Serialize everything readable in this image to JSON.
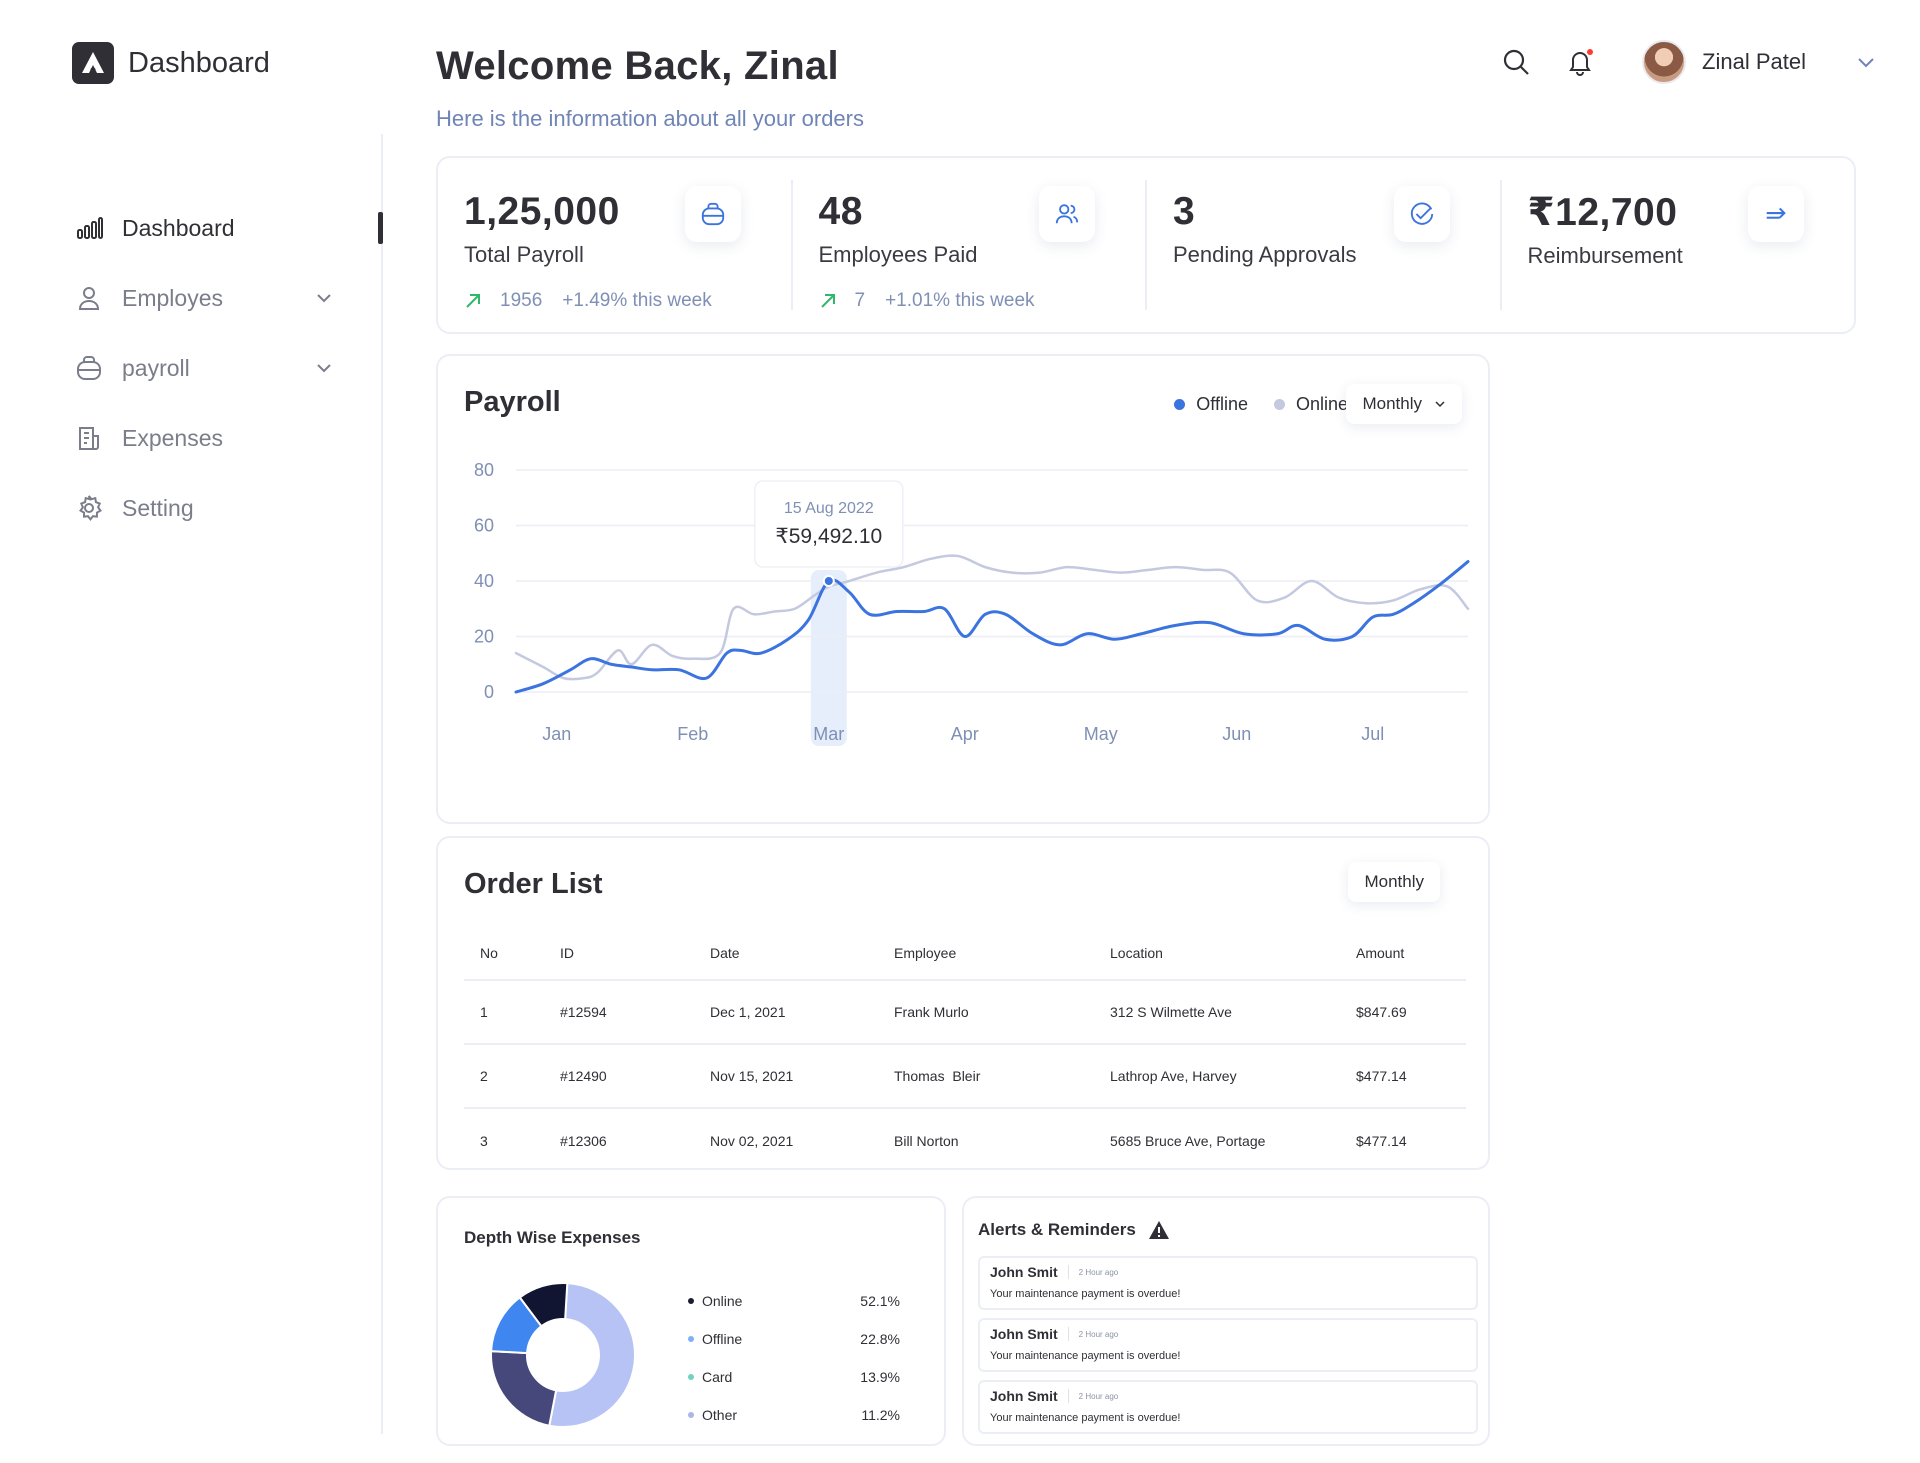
{
  "app": {
    "logo_text": "Dashboard"
  },
  "sidebar": {
    "items": [
      {
        "label": "Dashboard",
        "icon": "bar-chart-icon",
        "active": true,
        "expandable": false
      },
      {
        "label": "Employes",
        "icon": "user-icon",
        "active": false,
        "expandable": true
      },
      {
        "label": "payroll",
        "icon": "bag-icon",
        "active": false,
        "expandable": true
      },
      {
        "label": "Expenses",
        "icon": "document-icon",
        "active": false,
        "expandable": false
      },
      {
        "label": "Setting",
        "icon": "gear-icon",
        "active": false,
        "expandable": false
      }
    ]
  },
  "header": {
    "title": "Welcome Back, Zinal",
    "subtitle": "Here is the information about all your orders",
    "user_name": "Zinal Patel"
  },
  "stats": [
    {
      "value": "1,25,000",
      "label": "Total Payroll",
      "trend_count": "1956",
      "trend_text": "+1.49% this week",
      "icon": "bag-icon"
    },
    {
      "value": "48",
      "label": "Employees Paid",
      "trend_count": "7",
      "trend_text": "+1.01% this week",
      "icon": "users-icon"
    },
    {
      "value": "3",
      "label": "Pending Approvals",
      "trend_count": "",
      "trend_text": "",
      "icon": "check-circle-icon"
    },
    {
      "value": "₹12,700",
      "label": "Reimbursement",
      "trend_count": "",
      "trend_text": "",
      "icon": "arrow-right-icon"
    }
  ],
  "payroll": {
    "title": "Payroll",
    "legend": {
      "offline": "Offline",
      "online": "Online"
    },
    "period": "Monthly",
    "tooltip": {
      "date": "15 Aug 2022",
      "value": "₹59,492.10"
    }
  },
  "chart_data": {
    "type": "line",
    "title": "Payroll",
    "categories": [
      "Jan",
      "Feb",
      "Mar",
      "Apr",
      "May",
      "Jun",
      "Jul"
    ],
    "yticks": [
      "80",
      "60",
      "40",
      "20",
      "0"
    ],
    "ylim": [
      0,
      80
    ],
    "xlim": [
      0,
      7
    ],
    "grid": true,
    "legend_position": "top-right",
    "highlight_x": 2.3,
    "series": [
      {
        "name": "Offline",
        "color": "#3b73df",
        "x": [
          0,
          0.2,
          0.4,
          0.55,
          0.7,
          0.85,
          1.0,
          1.2,
          1.4,
          1.55,
          1.65,
          1.8,
          2.0,
          2.15,
          2.3,
          2.45,
          2.6,
          2.8,
          3.0,
          3.15,
          3.3,
          3.45,
          3.6,
          3.8,
          4.0,
          4.2,
          4.4,
          4.6,
          4.85,
          5.1,
          5.35,
          5.6,
          5.75,
          5.95,
          6.15,
          6.3,
          6.45,
          6.6,
          6.8,
          7.0
        ],
        "y": [
          0,
          3,
          8,
          12,
          10,
          9,
          8,
          8,
          5,
          14,
          15,
          14,
          19,
          26,
          40,
          36,
          28,
          29,
          29,
          30,
          20,
          28,
          28,
          21,
          17,
          21,
          19,
          21,
          24,
          25,
          21,
          21,
          24,
          19,
          20,
          27,
          28,
          32,
          39,
          47
        ]
      },
      {
        "name": "Online",
        "color": "#c4c9e0",
        "x": [
          0,
          0.2,
          0.35,
          0.5,
          0.6,
          0.75,
          0.85,
          1.0,
          1.15,
          1.3,
          1.5,
          1.6,
          1.75,
          1.9,
          2.05,
          2.2,
          2.3,
          2.45,
          2.65,
          2.85,
          3.05,
          3.25,
          3.45,
          3.65,
          3.85,
          4.05,
          4.25,
          4.45,
          4.65,
          4.85,
          5.05,
          5.25,
          5.45,
          5.65,
          5.85,
          6.05,
          6.25,
          6.45,
          6.65,
          6.85,
          7.0
        ],
        "y": [
          14,
          9,
          5,
          5,
          7,
          15,
          10,
          17,
          13,
          12,
          14,
          30,
          28,
          29,
          30,
          35,
          38,
          40,
          43,
          45,
          48,
          49,
          45,
          43,
          43,
          45,
          44,
          43,
          44,
          45,
          44,
          43,
          33,
          34,
          40,
          34,
          32,
          33,
          37,
          38,
          30
        ]
      }
    ]
  },
  "orders": {
    "title": "Order List",
    "period": "Monthly",
    "columns": [
      "No",
      "ID",
      "Date",
      "Employee",
      "Location",
      "Amount"
    ],
    "rows": [
      [
        "1",
        "#12594",
        "Dec 1, 2021",
        "Frank Murlo",
        "312 S Wilmette Ave",
        "$847.69"
      ],
      [
        "2",
        "#12490",
        "Nov 15, 2021",
        "Thomas  Bleir",
        "Lathrop Ave, Harvey",
        "$477.14"
      ],
      [
        "3",
        "#12306",
        "Nov 02, 2021",
        "Bill Norton",
        "5685 Bruce Ave, Portage",
        "$477.14"
      ]
    ]
  },
  "expenses": {
    "title": "Depth Wise Expenses",
    "items": [
      {
        "label": "Online",
        "value": "52.1%",
        "color": "#1b1e2e",
        "slice_color": "#b6c3f4",
        "share": 52.1
      },
      {
        "label": "Offline",
        "value": "22.8%",
        "color": "#7fb0f5",
        "slice_color": "#46477a",
        "share": 22.8
      },
      {
        "label": "Card",
        "value": "13.9%",
        "color": "#6ed3c0",
        "slice_color": "#3f86f0",
        "share": 13.9
      },
      {
        "label": "Other",
        "value": "11.2%",
        "color": "#a9b6e8",
        "slice_color": "#111532",
        "share": 11.2
      }
    ]
  },
  "alerts": {
    "title": "Alerts & Reminders",
    "items": [
      {
        "name": "John Smit",
        "time": "2 Hour ago",
        "message": "Your maintenance payment is overdue!"
      },
      {
        "name": "John Smit",
        "time": "2 Hour ago",
        "message": "Your maintenance payment is overdue!"
      },
      {
        "name": "John Smit",
        "time": "2 Hour ago",
        "message": "Your maintenance payment is overdue!"
      }
    ]
  },
  "colors": {
    "accent": "#3b73df",
    "muted_text": "#7f8fb5",
    "trend_up": "#2fb86a",
    "border": "#eceef6"
  }
}
